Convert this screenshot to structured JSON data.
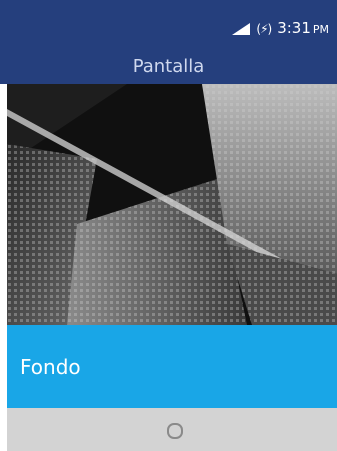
{
  "status_bar": {
    "signal_icon": "signal-icon",
    "battery_icon": "battery-charging-icon",
    "battery_glyph": "(⚡)",
    "time": "3:31",
    "ampm": "PM"
  },
  "header": {
    "title": "Pantalla"
  },
  "wallpaper": {
    "icon": "wallpaper-image"
  },
  "menu": {
    "items": [
      {
        "label": "Fondo",
        "selected": true
      }
    ]
  },
  "softkeys": {
    "center_icon": "home-circle-icon"
  },
  "colors": {
    "header_bg": "#253f7d",
    "selection": "#19a6e7",
    "softkey_bg": "#d3d3d3"
  }
}
